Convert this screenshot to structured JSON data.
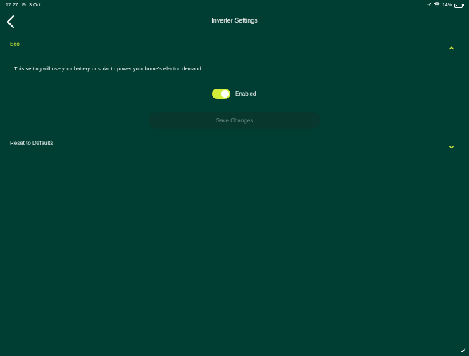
{
  "status_bar": {
    "time": "17:27",
    "date": "Fri 3 Oct",
    "battery_percent": "14%",
    "icons": [
      "location-icon",
      "wifi-icon",
      "battery-icon"
    ]
  },
  "nav": {
    "title": "Inverter Settings",
    "back_icon": "chevron-left-icon"
  },
  "sections": {
    "eco": {
      "title": "Eco",
      "expanded": true,
      "description": "This setting will use your battery or solar to power your home's electric demand",
      "toggle_label": "Enabled",
      "toggle_on": true,
      "save_label": "Save Changes"
    },
    "reset": {
      "title": "Reset to Defaults",
      "expanded": false
    }
  },
  "colors": {
    "background": "#003d32",
    "accent": "#d4ec3a",
    "button_bg": "#07372d",
    "button_text_disabled": "#6b8a80"
  }
}
